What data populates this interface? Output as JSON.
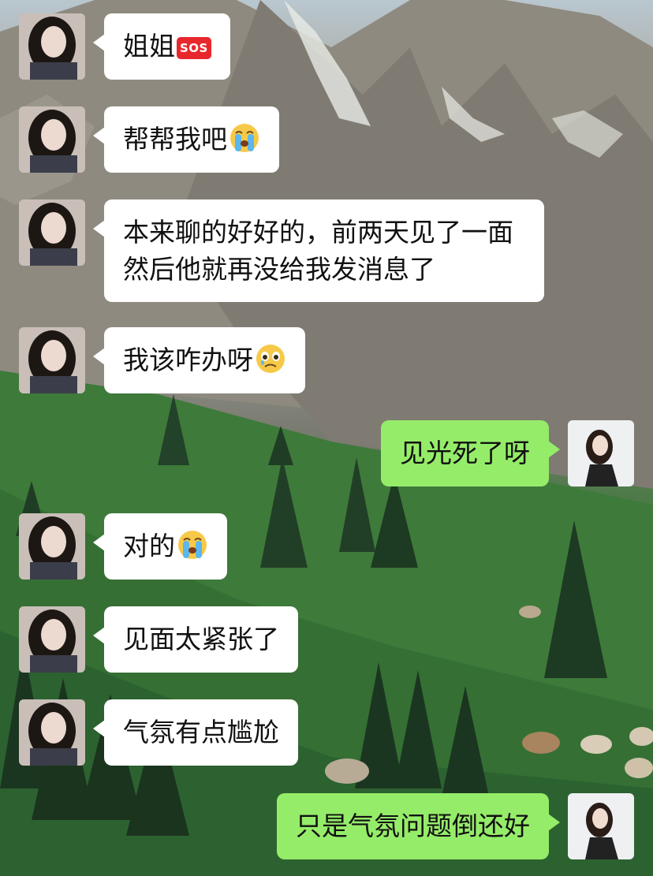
{
  "colors": {
    "incoming_bubble": "#ffffff",
    "outgoing_bubble": "#95ec69",
    "text": "#111111"
  },
  "messages": [
    {
      "side": "left",
      "text": "姐姐",
      "badge": "SOS"
    },
    {
      "side": "left",
      "text": "帮帮我吧",
      "emoji": "loudly-crying-face"
    },
    {
      "side": "left",
      "text": "本来聊的好好的，前两天见了一面然后他就再没给我发消息了"
    },
    {
      "side": "left",
      "text": "我该咋办呀",
      "emoji": "face-holding-back-tears"
    },
    {
      "side": "right",
      "text": "见光死了呀"
    },
    {
      "side": "left",
      "text": "对的",
      "emoji": "loudly-crying-face"
    },
    {
      "side": "left",
      "text": "见面太紧张了"
    },
    {
      "side": "left",
      "text": "气氛有点尴尬"
    },
    {
      "side": "right",
      "text": "只是气氛问题倒还好"
    }
  ]
}
